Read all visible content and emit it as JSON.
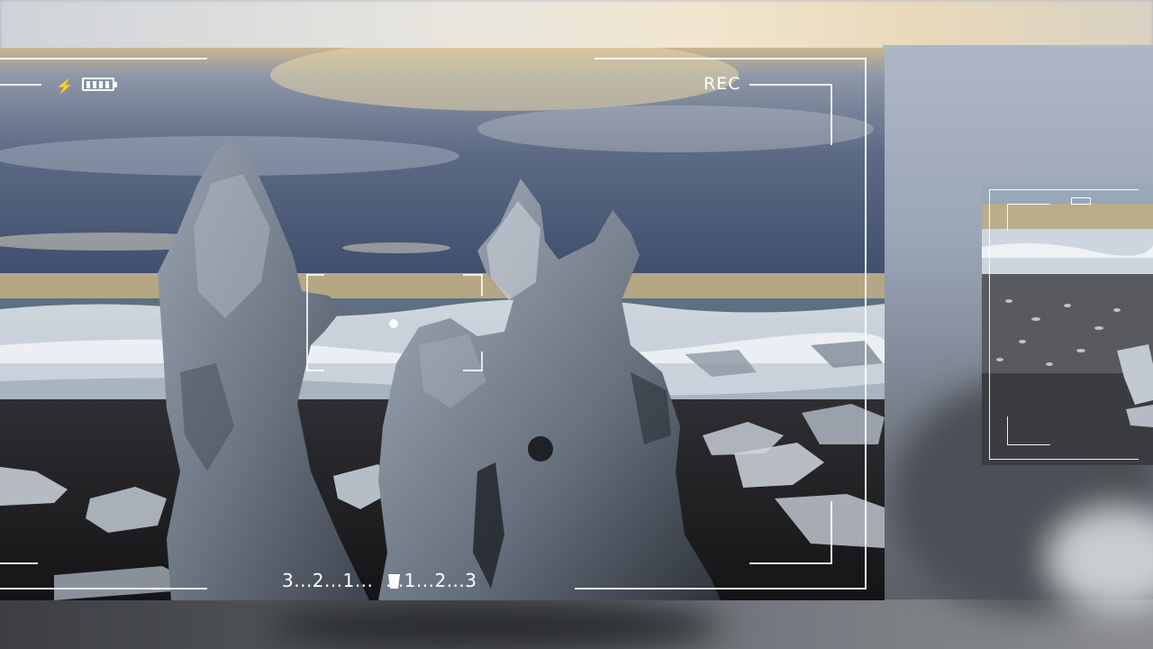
{
  "viewfinder": {
    "rec_label": "REC",
    "countdown_label": "3...2...1...  ...1...2...3",
    "battery_icon": "battery-icon",
    "flash_icon": "lightning-bolt-icon",
    "shutter_icon": "shutter-icon"
  },
  "colors": {
    "overlay": "#ffffff",
    "sky": "#5d6f8c",
    "sand": "#b7a98a",
    "ice": "#8d98a6"
  }
}
